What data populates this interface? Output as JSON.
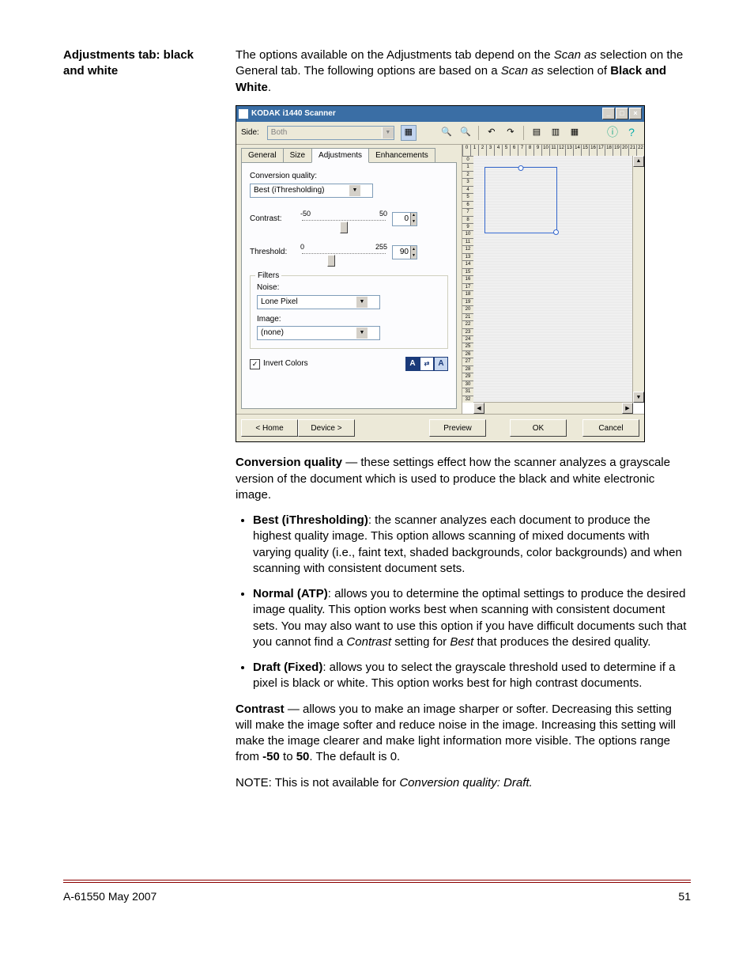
{
  "heading": "Adjustments tab: black and white",
  "intro": {
    "p1a": "The options available on the Adjustments tab depend on the ",
    "p1b": "Scan as",
    "p1c": " selection on the General tab. The following options are based on a ",
    "p1d": "Scan as",
    "p1e": " selection of ",
    "p1f": "Black and White",
    "p1g": "."
  },
  "window": {
    "title": "KODAK i1440 Scanner",
    "side_label": "Side:",
    "side_value": "Both",
    "tabs": {
      "general": "General",
      "size": "Size",
      "adjustments": "Adjustments",
      "enhancements": "Enhancements"
    },
    "conv_label": "Conversion quality:",
    "conv_value": "Best (iThresholding)",
    "contrast": {
      "label": "Contrast:",
      "min": "-50",
      "max": "50",
      "value": "0"
    },
    "threshold": {
      "label": "Threshold:",
      "min": "0",
      "max": "255",
      "value": "90"
    },
    "filters": {
      "title": "Filters",
      "noise_label": "Noise:",
      "noise_value": "Lone Pixel",
      "image_label": "Image:",
      "image_value": "(none)"
    },
    "invert_label": "Invert Colors",
    "buttons": {
      "home": "< Home",
      "device": "Device >",
      "preview": "Preview",
      "ok": "OK",
      "cancel": "Cancel"
    }
  },
  "conv_quality": {
    "lead_bold": "Conversion quality",
    "lead_rest": " — these settings effect how the scanner analyzes a grayscale version of the document which is used to produce the black and white electronic image.",
    "best_bold": "Best (iThresholding)",
    "best_rest": ": the scanner analyzes each document to produce the highest quality image. This option allows scanning of mixed documents with varying quality (i.e., faint text, shaded backgrounds, color backgrounds) and when scanning with consistent document sets.",
    "normal_bold": "Normal (ATP)",
    "normal_rest1": ": allows you to determine the optimal settings to produce the desired image quality. This option works best when scanning with consistent document sets. You may also want to use this option if you have difficult documents such that you cannot find a ",
    "normal_em1": "Contrast",
    "normal_rest2": " setting for ",
    "normal_em2": "Best",
    "normal_rest3": " that produces the desired quality.",
    "draft_bold": "Draft (Fixed)",
    "draft_rest": ": allows you to select the grayscale threshold used to determine if a pixel is black or white. This option works best for high contrast documents."
  },
  "contrast_para": {
    "bold": "Contrast",
    "rest1": " — allows you to make an image sharper or softer. Decreasing this setting will make the image softer and reduce noise in the image. Increasing this setting will make the image clearer and make light information more visible. The options range from ",
    "b1": "-50",
    "rest2": " to ",
    "b2": "50",
    "rest3": ". The default is 0."
  },
  "note": {
    "lead": "NOTE: This is not available for ",
    "em": "Conversion quality: Draft."
  },
  "footer": {
    "left": "A-61550  May 2007",
    "right": "51"
  }
}
